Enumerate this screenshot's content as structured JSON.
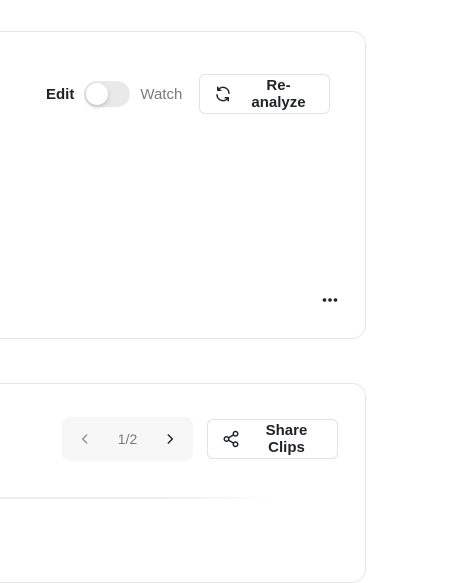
{
  "analysis_card": {
    "mode_toggle": {
      "edit_label": "Edit",
      "watch_label": "Watch",
      "state": "edit"
    },
    "reanalyze_button": {
      "label": "Re-analyze",
      "icon": "refresh-icon"
    },
    "more_menu": {
      "icon": "more-horizontal-icon"
    }
  },
  "clips_card": {
    "pager": {
      "prev_icon": "chevron-left-icon",
      "next_icon": "chevron-right-icon",
      "label": "1/2"
    },
    "share_button": {
      "label": "Share Clips",
      "icon": "share-icon"
    }
  },
  "colors": {
    "border": "#e6e6e6",
    "text_primary": "#1f2328",
    "text_muted": "#7a7a7a",
    "toggle_track": "#e9e9e9",
    "pager_bg": "#f7f7f7"
  }
}
